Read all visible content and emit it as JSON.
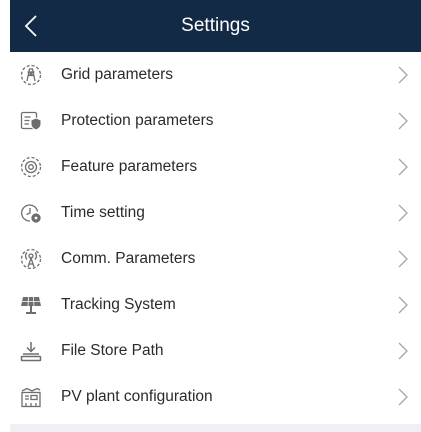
{
  "header": {
    "title": "Settings",
    "background": "#132a46",
    "back_icon": "chevron-left-icon"
  },
  "settings": {
    "items": [
      {
        "label": "Grid parameters",
        "icon": "grid-parameters-icon"
      },
      {
        "label": "Protection parameters",
        "icon": "protection-parameters-icon"
      },
      {
        "label": "Feature parameters",
        "icon": "feature-parameters-icon"
      },
      {
        "label": "Time setting",
        "icon": "time-setting-icon"
      },
      {
        "label": "Comm. Parameters",
        "icon": "comm-parameters-icon"
      },
      {
        "label": "Tracking System",
        "icon": "tracking-system-icon"
      },
      {
        "label": "File Store Path",
        "icon": "file-store-path-icon"
      },
      {
        "label": "PV plant configuration",
        "icon": "pv-plant-configuration-icon"
      }
    ],
    "chevron_icon": "chevron-right-icon",
    "text_color": "#2b2b2b",
    "icon_color": "#6e6e6e",
    "chevron_color": "#a6a6a6"
  }
}
